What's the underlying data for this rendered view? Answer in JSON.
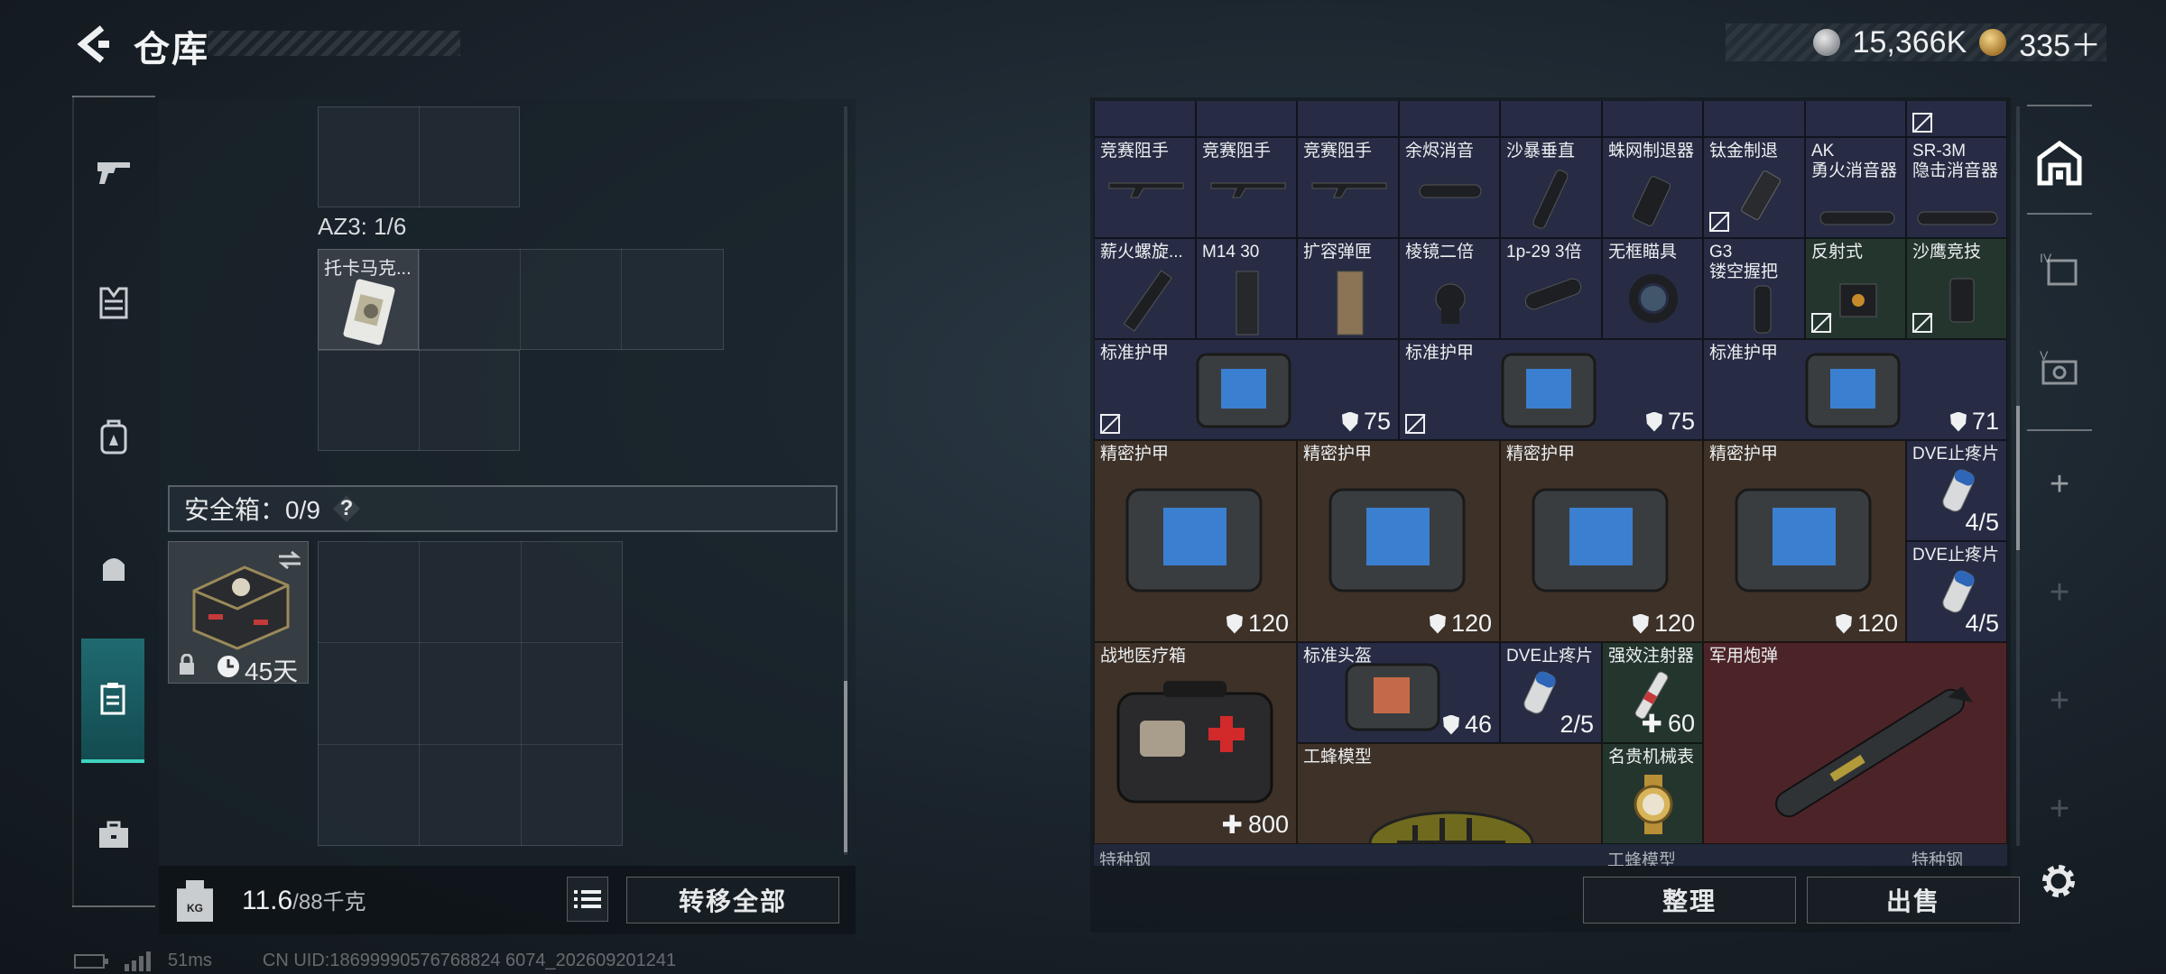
{
  "header": {
    "title": "仓库",
    "currency_silver": "15,366K",
    "currency_gold": "335＋"
  },
  "sidebar": {
    "items": [
      {
        "icon": "gun-icon"
      },
      {
        "icon": "vest-icon"
      },
      {
        "icon": "backpack-icon"
      },
      {
        "icon": "bag-icon"
      },
      {
        "icon": "safebox-icon",
        "active": true
      },
      {
        "icon": "briefcase-icon"
      }
    ]
  },
  "left_panel": {
    "container_label": "AZ3: 1/6",
    "container_item": "托卡马克...",
    "safebox_label": "安全箱：0/9",
    "safebox_help": "?",
    "safebox_duration": "45天",
    "weight_value": "11.6",
    "weight_max": "/88千克",
    "weight_icon_label": "KG",
    "transfer_all": "转移全部"
  },
  "status_bar": {
    "ping": "51ms",
    "uid": "CN UID:18699990576768824 6074_202609201241"
  },
  "inventory": {
    "row0": [
      "竞赛阻手",
      "竞赛阻手",
      "竞赛阻手",
      "余烬消音",
      "沙暴垂直",
      "蛛网制退器",
      "钛金制退",
      "AK\n勇火消音器",
      "SR-3M\n隐击消音器"
    ],
    "row1": [
      "薪火螺旋...",
      "M14 30",
      "扩容弹匣",
      "棱镜二倍",
      "1p-29 3倍",
      "无框瞄具",
      "G3\n镂空握把",
      "反射式",
      "沙鹰竞技"
    ],
    "armor_std": [
      {
        "name": "标准护甲",
        "val": "75"
      },
      {
        "name": "标准护甲",
        "val": "75"
      },
      {
        "name": "标准护甲",
        "val": "71"
      }
    ],
    "armor_precise": [
      {
        "name": "精密护甲",
        "val": "120"
      },
      {
        "name": "精密护甲",
        "val": "120"
      },
      {
        "name": "精密护甲",
        "val": "120"
      },
      {
        "name": "精密护甲",
        "val": "120"
      }
    ],
    "dve": [
      {
        "name": "DVE止疼片",
        "val": "4/5"
      },
      {
        "name": "DVE止疼片",
        "val": "4/5"
      },
      {
        "name": "DVE止疼片",
        "val": "2/5"
      }
    ],
    "medkit": {
      "name": "战地医疗箱",
      "val": "800"
    },
    "helmet": {
      "name": "标准头盔",
      "val": "46"
    },
    "injector": {
      "name": "强效注射器",
      "val": "60"
    },
    "missile": {
      "name": "军用炮弹"
    },
    "bee": {
      "name": "工蜂模型"
    },
    "watch": {
      "name": "名贵机械表"
    },
    "cut_labels": [
      "特种钢",
      "工蜂模型",
      "特种钢"
    ],
    "sort": "整理",
    "sell": "出售"
  },
  "colors": {
    "accent_teal": "#3fd2c0",
    "armor_bg": "#332d30",
    "green_bg": "#24352e",
    "red_bg": "#4c2428"
  }
}
